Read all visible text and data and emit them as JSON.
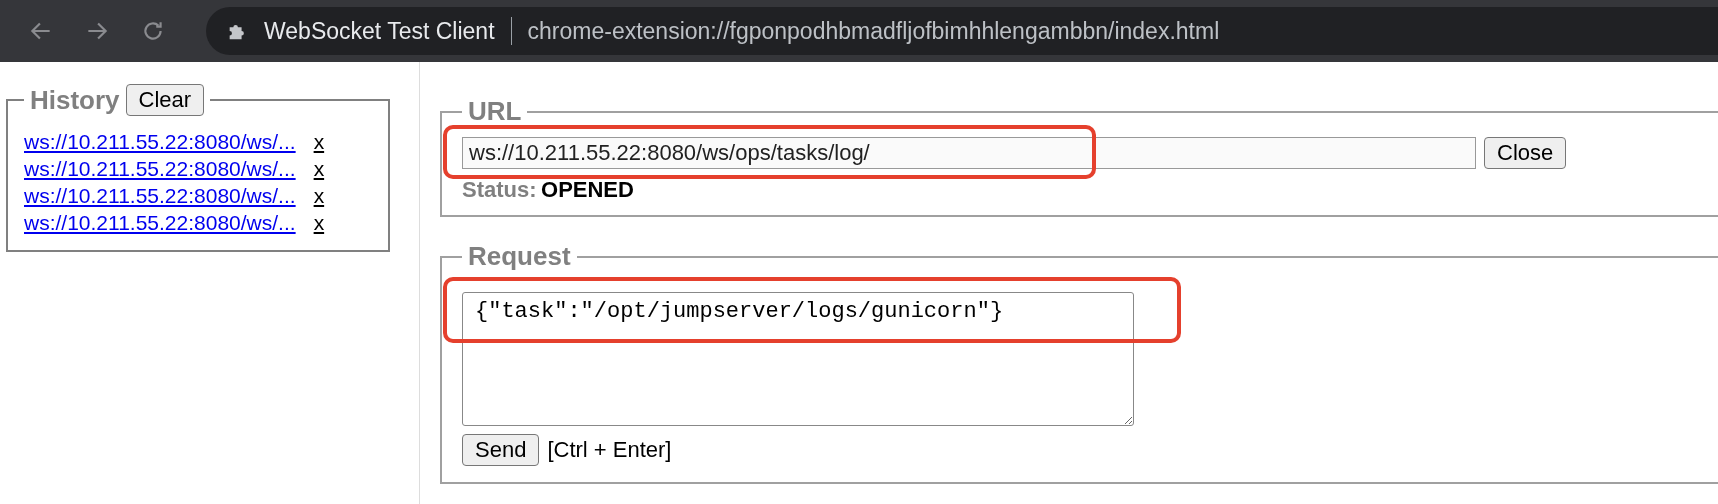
{
  "browser": {
    "page_title": "WebSocket Test Client",
    "address": "chrome-extension://fgponpodhbmadfljofbimhhlengambbn/index.html"
  },
  "history": {
    "legend": "History",
    "clear_button": "Clear",
    "items": [
      {
        "url": "ws://10.211.55.22:8080/ws/...",
        "remove": "x"
      },
      {
        "url": "ws://10.211.55.22:8080/ws/...",
        "remove": "x"
      },
      {
        "url": "ws://10.211.55.22:8080/ws/...",
        "remove": "x"
      },
      {
        "url": "ws://10.211.55.22:8080/ws/...",
        "remove": "x"
      }
    ]
  },
  "url_section": {
    "legend": "URL",
    "value": "ws://10.211.55.22:8080/ws/ops/tasks/log/",
    "button": "Close",
    "status_label": "Status:",
    "status": "OPENED"
  },
  "request_section": {
    "legend": "Request",
    "value": "{\"task\":\"/opt/jumpserver/logs/gunicorn\"}",
    "send_button": "Send",
    "shortcut": "[Ctrl + Enter]"
  }
}
